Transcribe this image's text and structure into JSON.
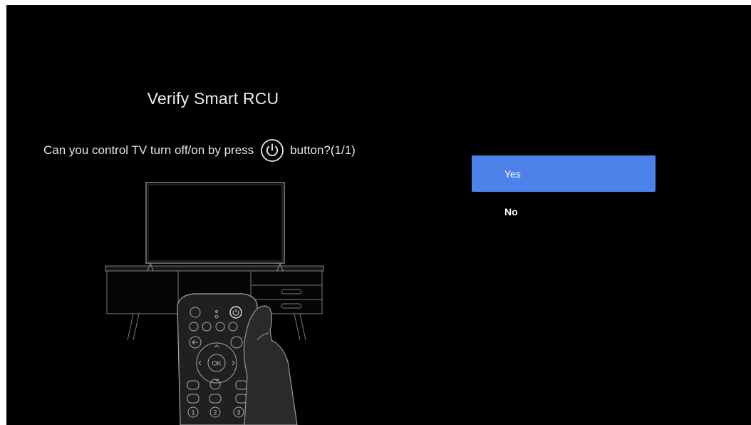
{
  "dialog": {
    "title": "Verify Smart RCU",
    "question_prefix": "Can you control TV turn off/on by press",
    "question_suffix": "button?(1/1)",
    "question_icon": "power-icon"
  },
  "options": [
    {
      "label": "Yes",
      "selected": true
    },
    {
      "label": "No",
      "selected": false
    }
  ],
  "remote": {
    "ok_label": "OK",
    "number_keys": [
      "1",
      "2",
      "3"
    ]
  },
  "colors": {
    "background": "#000000",
    "accent": "#4c82ea",
    "text": "#ffffff",
    "line_art": "#8a8a8a"
  }
}
